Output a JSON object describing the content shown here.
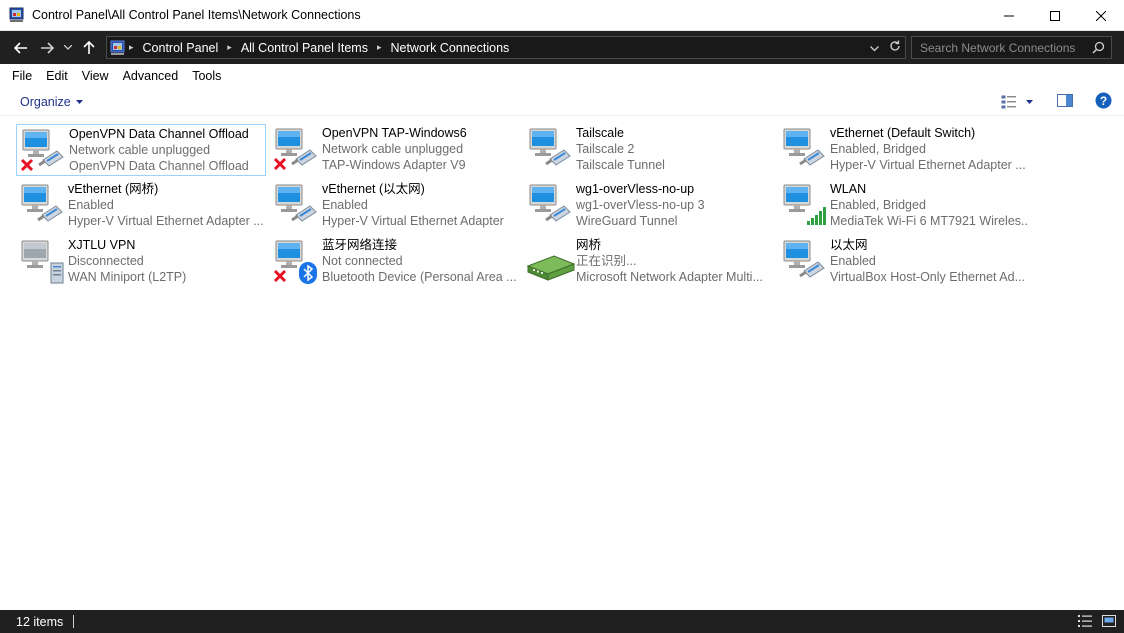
{
  "window": {
    "title": "Control Panel\\All Control Panel Items\\Network Connections"
  },
  "address": {
    "breadcrumbs": [
      "Control Panel",
      "All Control Panel Items",
      "Network Connections"
    ]
  },
  "search": {
    "placeholder": "Search Network Connections"
  },
  "menu": [
    "File",
    "Edit",
    "View",
    "Advanced",
    "Tools"
  ],
  "toolbar": {
    "organize_label": "Organize"
  },
  "colors": {
    "accent": "#0078d7",
    "dark_bar": "#202020",
    "organize_text": "#1e3287",
    "error_red": "#e81123"
  },
  "items": [
    {
      "name": "OpenVPN Data Channel Offload",
      "status": "Network cable unplugged",
      "device": "OpenVPN Data Channel Offload",
      "icon": "network-adapter-icon",
      "overlay": "red-x-icon",
      "selected": true
    },
    {
      "name": "OpenVPN TAP-Windows6",
      "status": "Network cable unplugged",
      "device": "TAP-Windows Adapter V9",
      "icon": "network-adapter-icon",
      "overlay": "red-x-icon"
    },
    {
      "name": "Tailscale",
      "status": "Tailscale 2",
      "device": "Tailscale Tunnel",
      "icon": "network-adapter-icon",
      "overlay": ""
    },
    {
      "name": "vEthernet (Default Switch)",
      "status": "Enabled, Bridged",
      "device": "Hyper-V Virtual Ethernet Adapter ...",
      "icon": "network-adapter-icon",
      "overlay": ""
    },
    {
      "name": "vEthernet (网桥)",
      "status": "Enabled",
      "device": "Hyper-V Virtual Ethernet Adapter ...",
      "icon": "network-adapter-icon",
      "overlay": ""
    },
    {
      "name": "vEthernet (以太网)",
      "status": "Enabled",
      "device": "Hyper-V Virtual Ethernet Adapter",
      "icon": "network-adapter-icon",
      "overlay": ""
    },
    {
      "name": "wg1-overVless-no-up",
      "status": "wg1-overVless-no-up 3",
      "device": "WireGuard Tunnel",
      "icon": "network-adapter-icon",
      "overlay": ""
    },
    {
      "name": "WLAN",
      "status": "Enabled, Bridged",
      "device": "MediaTek Wi-Fi 6 MT7921 Wireles...",
      "icon": "network-adapter-icon",
      "overlay": "wifi-signal-icon"
    },
    {
      "name": "XJTLU VPN",
      "status": "Disconnected",
      "device": "WAN Miniport (L2TP)",
      "icon": "vpn-computer-icon",
      "overlay": "server-icon"
    },
    {
      "name": "蓝牙网络连接",
      "status": "Not connected",
      "device": "Bluetooth Device (Personal Area ...",
      "icon": "network-adapter-icon",
      "overlay": "bluetooth-icon"
    },
    {
      "name": "网桥",
      "status": "正在识别...",
      "device": "Microsoft Network Adapter Multi...",
      "icon": "network-bridge-icon",
      "overlay": ""
    },
    {
      "name": "以太网",
      "status": "Enabled",
      "device": "VirtualBox Host-Only Ethernet Ad...",
      "icon": "network-adapter-icon",
      "overlay": ""
    }
  ],
  "statusbar": {
    "count": "12 items"
  }
}
